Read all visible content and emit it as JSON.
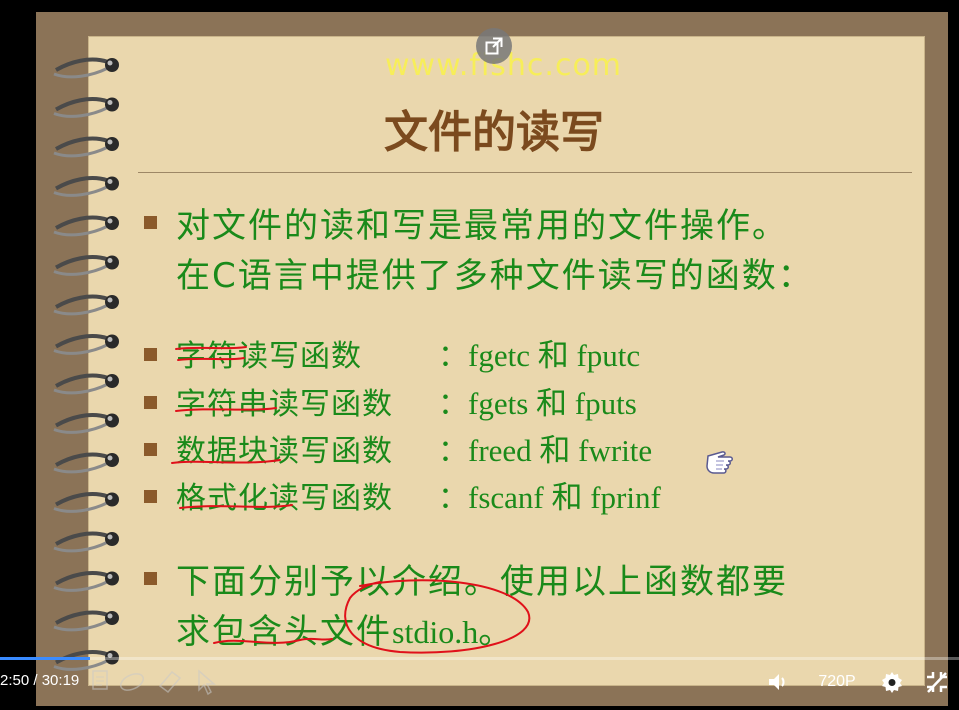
{
  "slide": {
    "watermark": "www.fishc.com",
    "title": "文件的读写",
    "intro": {
      "line1": "对文件的读和写是最常用的文件操作。",
      "line2": "在C语言中提供了多种文件读写的函数："
    },
    "functions": [
      {
        "label": "字符读写函数",
        "colon": "：",
        "funcs": "fgetc 和 fputc"
      },
      {
        "label": "字符串读写函数",
        "colon": "：",
        "funcs": "fgets 和 fputs"
      },
      {
        "label": "数据块读写函数",
        "colon": "：",
        "funcs": "freed 和 fwrite"
      },
      {
        "label": "格式化读写函数",
        "colon": "：",
        "funcs": "fscanf 和 fprinf"
      }
    ],
    "outro": {
      "line1": "下面分别予以介绍。使用以上函数都要",
      "line2_prefix": "求包含头文件",
      "line2_code": "stdio.h",
      "line2_suffix": "。"
    }
  },
  "player": {
    "current_time": "2:50",
    "separator": "/",
    "duration": "30:19",
    "progress_fraction": 0.0935,
    "quality": "720P",
    "icons": {
      "popout": "popout-icon",
      "volume": "volume-icon",
      "settings": "gear-icon",
      "fullscreen_exit": "fullscreen-exit-icon",
      "pen": "pen-icon",
      "eraser": "eraser-icon",
      "pointer": "pointer-icon",
      "note": "note-icon"
    }
  },
  "colors": {
    "text_green": "#1a8a1a",
    "title_brown": "#7b4a1e",
    "bullet_brown": "#8b5a2b",
    "paper": "#ead7ad",
    "frame": "#8b7357",
    "watermark": "#f7ee59",
    "annotation_red": "#e0101a"
  }
}
